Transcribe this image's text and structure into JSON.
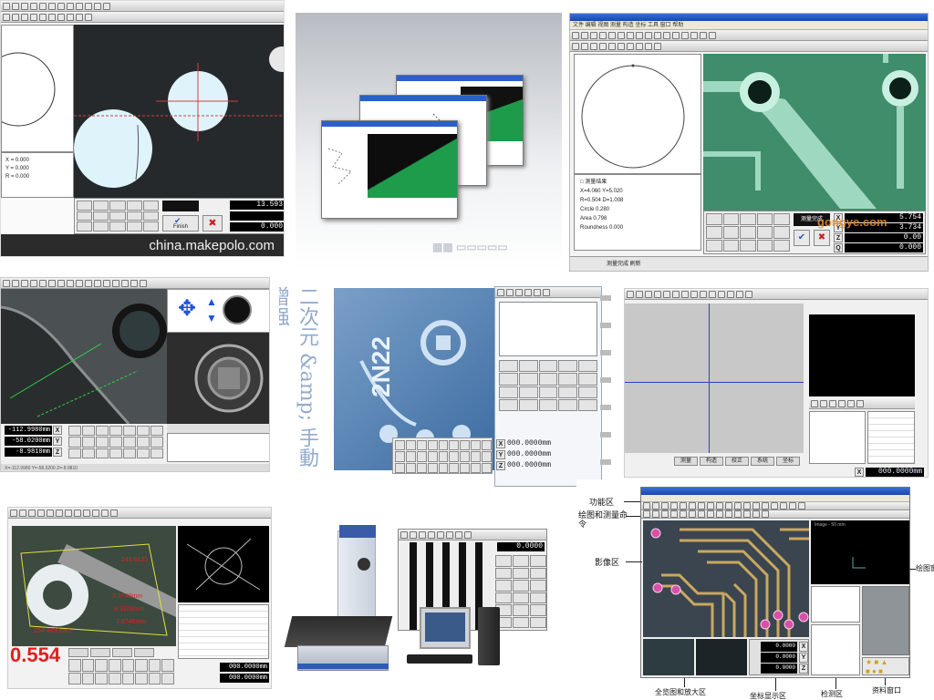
{
  "watermarks": {
    "tile1": "china.makepolo.com",
    "tile3": "gongye.com"
  },
  "tile1": {
    "readouts": [
      "13.593",
      "",
      "0.000"
    ],
    "button_label": "Finish",
    "info_lines": [
      "X = 0.000",
      "Y = 0.000",
      "R = 0.000"
    ]
  },
  "tile3": {
    "readouts": [
      "5.754",
      "3.734",
      "0.00",
      "0.000"
    ],
    "axes": [
      "X",
      "Y",
      "Z",
      "Q"
    ],
    "list_lines": [
      "□ 测量结果",
      "X=4.060  Y=5.020",
      "R=0.504  D=1.008",
      "Circle 0.280",
      "Area 0.798",
      "Roundness 0.000"
    ],
    "status": "测量完成  刷新"
  },
  "tile4": {
    "readouts": [
      "-112.9980mm",
      "-58.0200mm",
      "-8.9810mm"
    ],
    "axes": [
      "X",
      "Y",
      "Z"
    ],
    "status": "X=-112.9980  Y=-58.0200  Z=-8.9810"
  },
  "tile5": {
    "pcb_text": "2N22",
    "calligraphy": "二次元 &amp; 手動增强",
    "readouts": [
      "000.0000mm",
      "000.0000mm",
      "000.0000mm"
    ],
    "axes": [
      "X",
      "Y",
      "Z"
    ]
  },
  "tile6": {
    "readout": "000.0000mm",
    "axis": "X",
    "tabs": [
      "测量",
      "构造",
      "校正",
      "系统",
      "坐标"
    ]
  },
  "tile7": {
    "big_readout": "0.554",
    "measurements": [
      "243.6123",
      "3.3740mm",
      "6.3100mm",
      "7.8745mm",
      "254.4460mm"
    ],
    "readouts": [
      "000.0000mm",
      "000.0000mm"
    ]
  },
  "tile8": {
    "readout": "0.0000"
  },
  "tile9": {
    "labels": {
      "func": "功能区",
      "draw": "绘图和测量命令",
      "image": "影像区",
      "draw_window": "绘图窗口",
      "overview": "全览图和放大区",
      "coords": "坐标显示区",
      "detect": "检测区",
      "data": "资料窗口"
    },
    "readouts": [
      "0.0000",
      "0.0000",
      "0.0000"
    ],
    "axes": [
      "X",
      "Y",
      "Z"
    ],
    "window_label": "Image - 50 mm"
  },
  "colors": {
    "pcb_green": "#3f8d6a",
    "pcb_dark": "#1f5b40",
    "dark_scope": "#2a2f32",
    "blue_tint": "#4a7fb8",
    "gold_trace": "#c9a860",
    "magenta_pad": "#d850a8"
  }
}
